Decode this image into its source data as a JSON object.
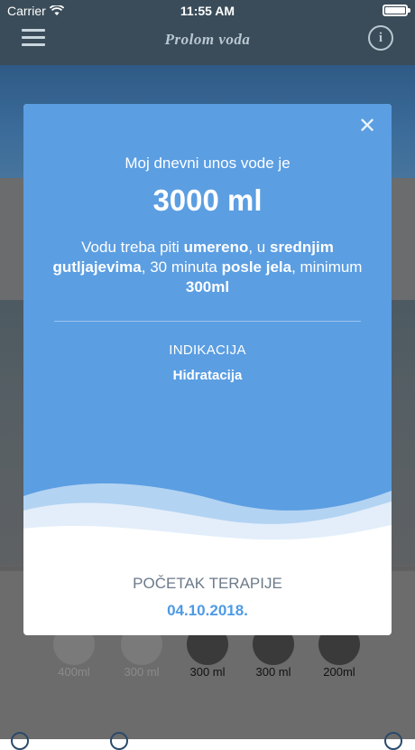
{
  "status_bar": {
    "carrier": "Carrier",
    "time": "11:55 AM"
  },
  "header": {
    "title": "Prolom voda",
    "info_glyph": "i"
  },
  "cups": [
    {
      "label": "400ml",
      "dimmed": true
    },
    {
      "label": "300 ml",
      "dimmed": true
    },
    {
      "label": "300 ml",
      "dimmed": false
    },
    {
      "label": "300 ml",
      "dimmed": false
    },
    {
      "label": "200ml",
      "dimmed": false
    }
  ],
  "modal": {
    "close_glyph": "✕",
    "intro": "Moj dnevni unos vode je",
    "amount": "3000 ml",
    "instructions": {
      "t1": "Vodu treba piti ",
      "b1": "umereno",
      "t2": ", u  ",
      "b2": "srednjim gutljajevima",
      "t3": ", 30 minuta ",
      "b3": "posle jela",
      "t4": ", minimum ",
      "b4": "300ml"
    },
    "indication_label": "INDIKACIJA",
    "indication_value": "Hidratacija",
    "start_label": "POČETAK TERAPIJE",
    "start_date": "04.10.2018."
  },
  "colors": {
    "modal_blue": "#5b9ee2",
    "date_blue": "#4f9ae4",
    "header_bg": "#3a4c59"
  }
}
